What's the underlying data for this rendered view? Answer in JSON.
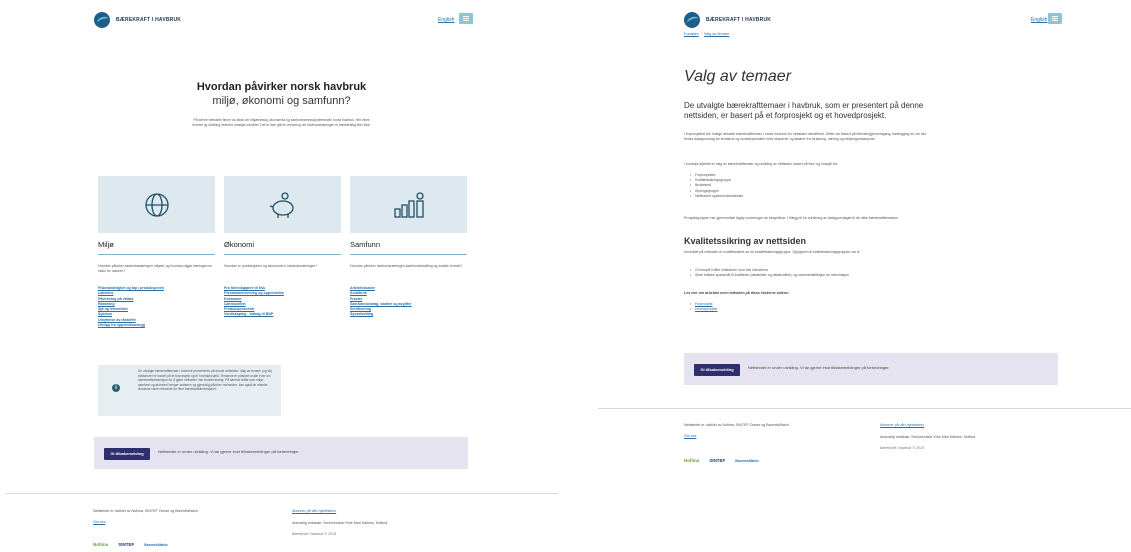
{
  "brand": {
    "name": "BÆREKRAFT I HAVBRUK"
  },
  "header": {
    "lang_link": "English"
  },
  "home": {
    "hero_title": "Hvordan påvirker norsk havbruk",
    "hero_subtitle": "miljø, økonomi og samfunn?",
    "hero_text": "På denne nettsiden finner du fakta om miljømessig, økonomisk og samfunnsmessig bærekraft i norsk havbruk. Her vises trender og utvikling innenfor utvalgte områder. Det er ikke gitt en vurdering om havbruksnæringen er bærekraftig eller ikke.",
    "themes": [
      {
        "title": "Miljø",
        "icon": "globe-icon",
        "description": "Hvordan påvirker havbruksnæringen miljøet, og hvordan utgjør næringen en risiko for naturen?",
        "links": [
          "Fiskedødelighet og tap i produksjonen",
          "Lakselus",
          "Påvirkning på villaks",
          "Rømming",
          "Sjø og lenemidler",
          "Sykdom",
          "Utnyttelse av råstoffet",
          "Utslipp fra oppdrettsanlegg"
        ]
      },
      {
        "title": "Økonomi",
        "icon": "piggy-bank-icon",
        "description": "Hvordan er produksjonen og økonomien i havbruksnæringen?",
        "links": [
          "Fra förinnkjøpere til fisk",
          "Försammensetning og opprinnelse",
          "Kostnader",
          "Lønnsomhet",
          "Produksjonsverdi",
          "Verdiskaping - bidrag til BNP"
        ]
      },
      {
        "title": "Samfunn",
        "icon": "community-chart-icon",
        "description": "Hvordan påvirker havbruksnæringen samfunnsutvikling og sosiale forhold?",
        "links": [
          "Arbeidsskader",
          "Arealbruk",
          "Fravær",
          "Samfunnsbidrag, skatter og avgifter",
          "Sertifisering",
          "Sysselsetting"
        ]
      }
    ],
    "info_text": "De utvalgte bærekrafttemaer i havbruk presenteres på denne nettsiden. Valg av temaer (og så) indikatorer er basert på et forprosjekt og et hovedprosjekt. Temaene er plassert under hver sin bærekraftsdimensjon for å gjøre nettsiden mer brukervennlig. På samme måte som miljø, samfunn og økonomi henger sammen og gjensidig påvirker hverandre, kan også de enkelte temaene være relevante for flere bærekraftdimensjoner."
  },
  "feedback": {
    "button": "Gi tilbakemelding",
    "text": "Nettstedet er under utvikling. Vi tar gjerne imot tilbakemeldinger på forbedringer."
  },
  "footer": {
    "developed_by": "Nettstedet er utviklet av Nofima, SINTEF Ocean og BarentsWatch.",
    "about": "Om oss",
    "newsletter": "Abonner på vårt nyhetsbrev",
    "editor": "Ansvarlig redaktør: Seniorforsker Kine Mari Karlsen, Nofima",
    "copyright": "Bærekraft i havbruk © 2019",
    "partners": [
      "Nofima",
      "SINTEF",
      "BarentsWatch"
    ]
  },
  "article": {
    "breadcrumb": [
      "Forsiden",
      "Valg av temaer"
    ],
    "title": "Valg av temaer",
    "lead": "De utvalgte bærekrafttemaer i havbruk, som er presentert på denne nettsiden, er basert på et forprosjekt og et hovedprosjekt.",
    "p1": "I forprosjektet ble mulige aktuelle bærekrafttemaer i norsk havbruk for nettsiden identifisert. Dette var basert på litteraturgjennomgang, kartlegging av om det finnes datagrunnlag for temaene og workshop/møter med eksperter og aktører fra forskning, næring og miljøorganisasjoner.",
    "p2": "I hovedprosjektet er valg av bærekrafttemaer og utvikling av nettsiden basert på funn og innspill fra:",
    "list1": [
      "Forprosjektet",
      "Kvalitetssikringsgruppe",
      "Brukertest",
      "Styringsgruppe",
      "Nettbasert spørreundersøkelse"
    ],
    "p3": "Prosjektgruppen har gjennomført faglig vurderinger av innspillene. I tillegg til en vurdering av datagrunnlaget til de ulike bærekrafttemaene.",
    "h2": "Kvalitetssikring av nettsiden",
    "p4": "Innholdet på nettsiden er kvalitetssikret av en kvalitetssikringsgruppe. Oppgaven til kvalitetssikringsgruppen var å:",
    "list2": [
      "Gi innspill hvilke indikatorer som bør inkluderes",
      "Sikre kritiske spørsmål til kvaliteten (datakilder og datakvalitet), og sammenstillingen av informasjon"
    ],
    "more": "Les mer om arbeidet med nettsiden på disse eksterne sidene:",
    "links": [
      "Forprosjekt",
      "Hovedprosjekt"
    ]
  }
}
